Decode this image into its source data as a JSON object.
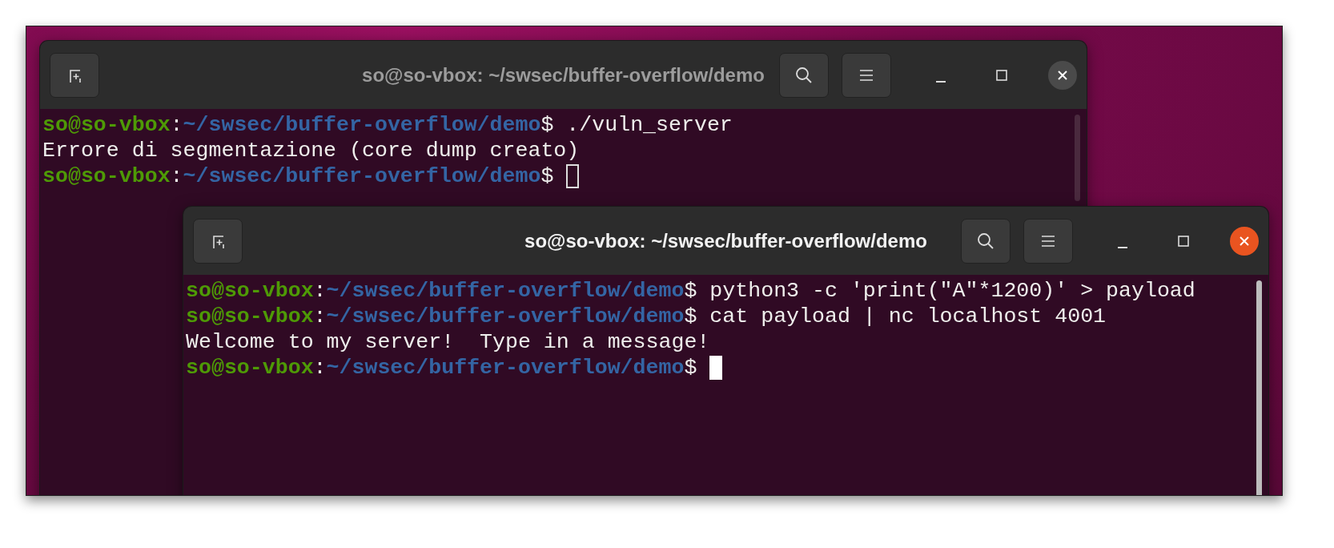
{
  "windows": [
    {
      "title": "so@so-vbox: ~/swsec/buffer-overflow/demo",
      "focused": false,
      "lines": [
        {
          "segments": [
            {
              "kind": "user",
              "text": "so@so-vbox"
            },
            {
              "kind": "plain",
              "text": ":"
            },
            {
              "kind": "path",
              "text": "~/swsec/buffer-overflow/demo"
            },
            {
              "kind": "plain",
              "text": "$ ./vuln_server"
            }
          ]
        },
        {
          "segments": [
            {
              "kind": "plain",
              "text": "Errore di segmentazione (core dump creato)"
            }
          ]
        },
        {
          "segments": [
            {
              "kind": "user",
              "text": "so@so-vbox"
            },
            {
              "kind": "plain",
              "text": ":"
            },
            {
              "kind": "path",
              "text": "~/swsec/buffer-overflow/demo"
            },
            {
              "kind": "plain",
              "text": "$"
            }
          ]
        }
      ]
    },
    {
      "title": "so@so-vbox: ~/swsec/buffer-overflow/demo",
      "focused": true,
      "lines": [
        {
          "segments": [
            {
              "kind": "user",
              "text": "so@so-vbox"
            },
            {
              "kind": "plain",
              "text": ":"
            },
            {
              "kind": "path",
              "text": "~/swsec/buffer-overflow/demo"
            },
            {
              "kind": "plain",
              "text": "$ python3 -c 'print(\"A\"*1200)' > payload"
            }
          ]
        },
        {
          "segments": [
            {
              "kind": "user",
              "text": "so@so-vbox"
            },
            {
              "kind": "plain",
              "text": ":"
            },
            {
              "kind": "path",
              "text": "~/swsec/buffer-overflow/demo"
            },
            {
              "kind": "plain",
              "text": "$ cat payload | nc localhost 4001"
            }
          ]
        },
        {
          "segments": [
            {
              "kind": "plain",
              "text": "Welcome to my server!  Type in a message!"
            }
          ]
        },
        {
          "segments": [
            {
              "kind": "user",
              "text": "so@so-vbox"
            },
            {
              "kind": "plain",
              "text": ":"
            },
            {
              "kind": "path",
              "text": "~/swsec/buffer-overflow/demo"
            },
            {
              "kind": "plain",
              "text": "$"
            }
          ]
        }
      ]
    }
  ]
}
